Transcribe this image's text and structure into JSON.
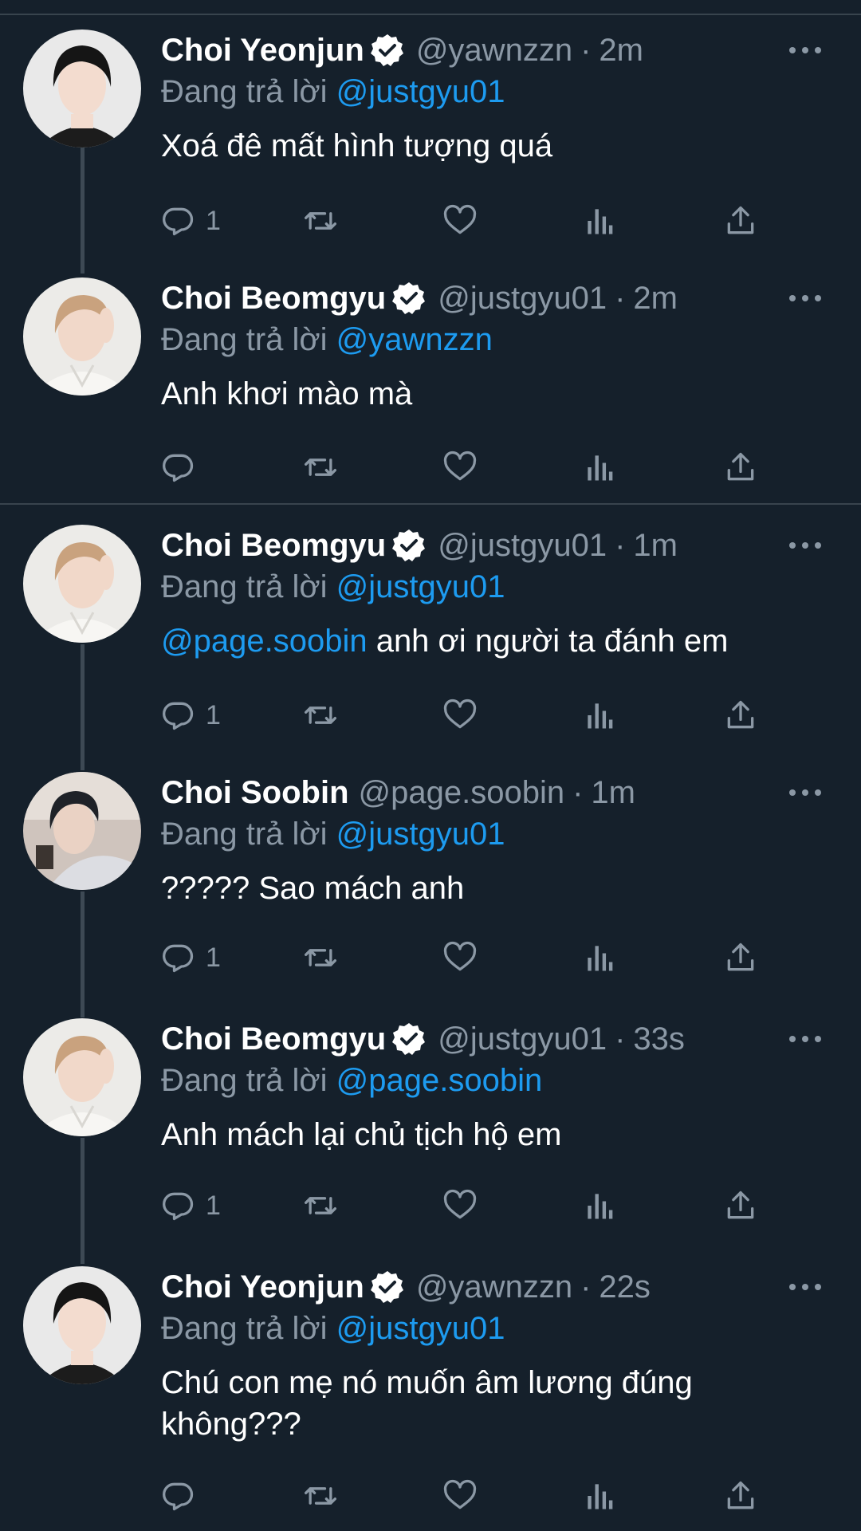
{
  "labels": {
    "replying_to": "Đang trả lời"
  },
  "colors": {
    "background": "#15202b",
    "secondary": "#8b98a5",
    "accent": "#1d9bf0",
    "divider": "#38444d"
  },
  "tweets": [
    {
      "name": "Choi Yeonjun",
      "verified": true,
      "handle": "@yawnzzn",
      "time": "2m",
      "reply_to": "@justgyu01",
      "mention": "",
      "text": "Xoá đê mất hình tượng quá",
      "reply_count": "1",
      "avatar": "avatar-yeonjun"
    },
    {
      "name": "Choi Beomgyu",
      "verified": true,
      "handle": "@justgyu01",
      "time": "2m",
      "reply_to": "@yawnzzn",
      "mention": "",
      "text": "Anh khơi mào mà",
      "reply_count": "",
      "avatar": "avatar-beomgyu"
    },
    {
      "name": "Choi Beomgyu",
      "verified": true,
      "handle": "@justgyu01",
      "time": "1m",
      "reply_to": "@justgyu01",
      "mention": "@page.soobin",
      "text": " anh ơi người ta đánh em",
      "reply_count": "1",
      "avatar": "avatar-beomgyu"
    },
    {
      "name": "Choi Soobin",
      "verified": false,
      "handle": "@page.soobin",
      "time": "1m",
      "reply_to": "@justgyu01",
      "mention": "",
      "text": "????? Sao mách anh",
      "reply_count": "1",
      "avatar": "avatar-soobin"
    },
    {
      "name": "Choi Beomgyu",
      "verified": true,
      "handle": "@justgyu01",
      "time": "33s",
      "reply_to": "@page.soobin",
      "mention": "",
      "text": "Anh mách lại chủ tịch hộ em",
      "reply_count": "1",
      "avatar": "avatar-beomgyu"
    },
    {
      "name": "Choi Yeonjun",
      "verified": true,
      "handle": "@yawnzzn",
      "time": "22s",
      "reply_to": "@justgyu01",
      "mention": "",
      "text": "Chú con mẹ nó muốn âm lương đúng không???",
      "reply_count": "",
      "avatar": "avatar-yeonjun"
    }
  ]
}
